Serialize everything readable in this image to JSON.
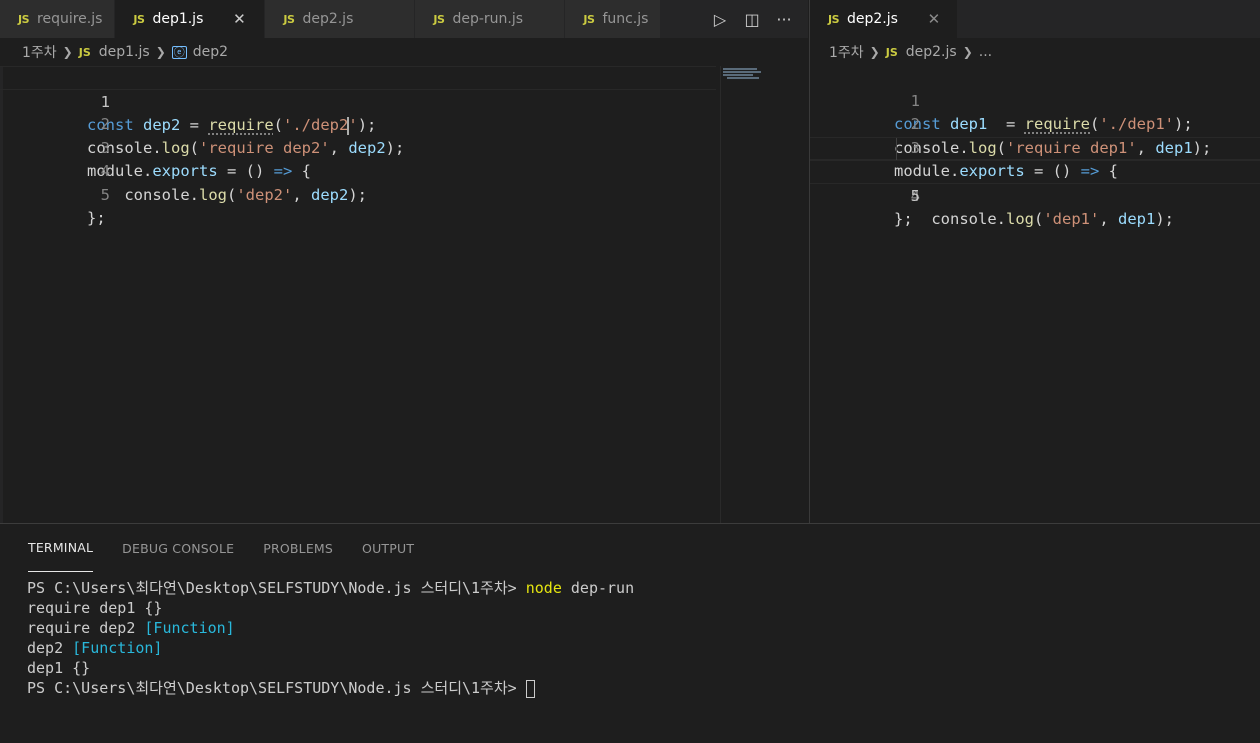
{
  "left_editor": {
    "tabs": [
      {
        "label": "require.js",
        "active": false
      },
      {
        "label": "dep1.js",
        "active": true
      },
      {
        "label": "dep2.js",
        "active": false
      },
      {
        "label": "dep-run.js",
        "active": false
      },
      {
        "label": "func.js",
        "active": false
      }
    ],
    "badge": "JS",
    "close_glyph": "✕",
    "breadcrumb": {
      "folder": "1주차",
      "file": "dep1.js",
      "symbol": "dep2"
    },
    "line_numbers": [
      "1",
      "2",
      "3",
      "4",
      "5"
    ],
    "code": {
      "l1": {
        "kw": "const",
        "var": "dep2",
        "op": " = ",
        "fn": "require",
        "open": "(",
        "str_a": "'./dep2",
        "str_b": "'",
        "close": ");"
      },
      "l2": {
        "obj": "console.",
        "fn": "log",
        "open": "(",
        "str": "'require dep2'",
        "mid": ", ",
        "var": "dep2",
        "close": ");"
      },
      "l3": {
        "obj": "module.",
        "prop": "exports",
        "op": " = () ",
        "arrow": "=>",
        "brace": " {"
      },
      "l4": {
        "indent": "    ",
        "obj": "console.",
        "fn": "log",
        "open": "(",
        "str": "'dep2'",
        "mid": ", ",
        "var": "dep2",
        "close": ");"
      },
      "l5": {
        "text": "};"
      }
    }
  },
  "right_editor": {
    "tab": {
      "label": "dep2.js",
      "active": true
    },
    "badge": "JS",
    "close_glyph": "✕",
    "breadcrumb": {
      "folder": "1주차",
      "file": "dep2.js",
      "more": "..."
    },
    "line_numbers": [
      "1",
      "2",
      "3",
      "4",
      "5"
    ],
    "code": {
      "l1": {
        "kw": "const",
        "var": "dep1",
        "op": "  = ",
        "fn": "require",
        "open": "(",
        "str": "'./dep1'",
        "close": ");"
      },
      "l2": {
        "obj": "console.",
        "fn": "log",
        "open": "(",
        "str": "'require dep1'",
        "mid": ", ",
        "var": "dep1",
        "close": ");"
      },
      "l3": {
        "obj": "module.",
        "prop": "exports",
        "op": " = () ",
        "arrow": "=>",
        "brace": " {"
      },
      "l4": {
        "indent": "    ",
        "obj": "console.",
        "fn": "log",
        "open": "(",
        "str": "'dep1'",
        "mid": ", ",
        "var": "dep1",
        "close": ");"
      },
      "l5": {
        "text": "};"
      }
    }
  },
  "editor_actions": {
    "run": "▷",
    "split": "◫",
    "more": "···"
  },
  "panel": {
    "tabs": [
      "TERMINAL",
      "DEBUG CONSOLE",
      "PROBLEMS",
      "OUTPUT"
    ],
    "active_tab": "TERMINAL",
    "terminal": {
      "prompt1": "PS C:\\Users\\최다연\\Desktop\\SELFSTUDY\\Node.js 스터디\\1주차> ",
      "command": "node",
      "command_arg": " dep-run",
      "out1": "require dep1 {}",
      "out2_text": "require dep2 ",
      "out2_fn": "[Function]",
      "out3_text": "dep2 ",
      "out3_fn": "[Function]",
      "out4": "dep1 {}",
      "prompt2": "PS C:\\Users\\최다연\\Desktop\\SELFSTUDY\\Node.js 스터디\\1주차> "
    }
  },
  "colors": {
    "keyword": "#569cd6",
    "variable": "#9cdcfe",
    "function": "#dcdcaa",
    "string": "#ce9178",
    "js_badge": "#cbcb41",
    "terminal_command": "#e5e510",
    "terminal_function": "#29b8db"
  }
}
